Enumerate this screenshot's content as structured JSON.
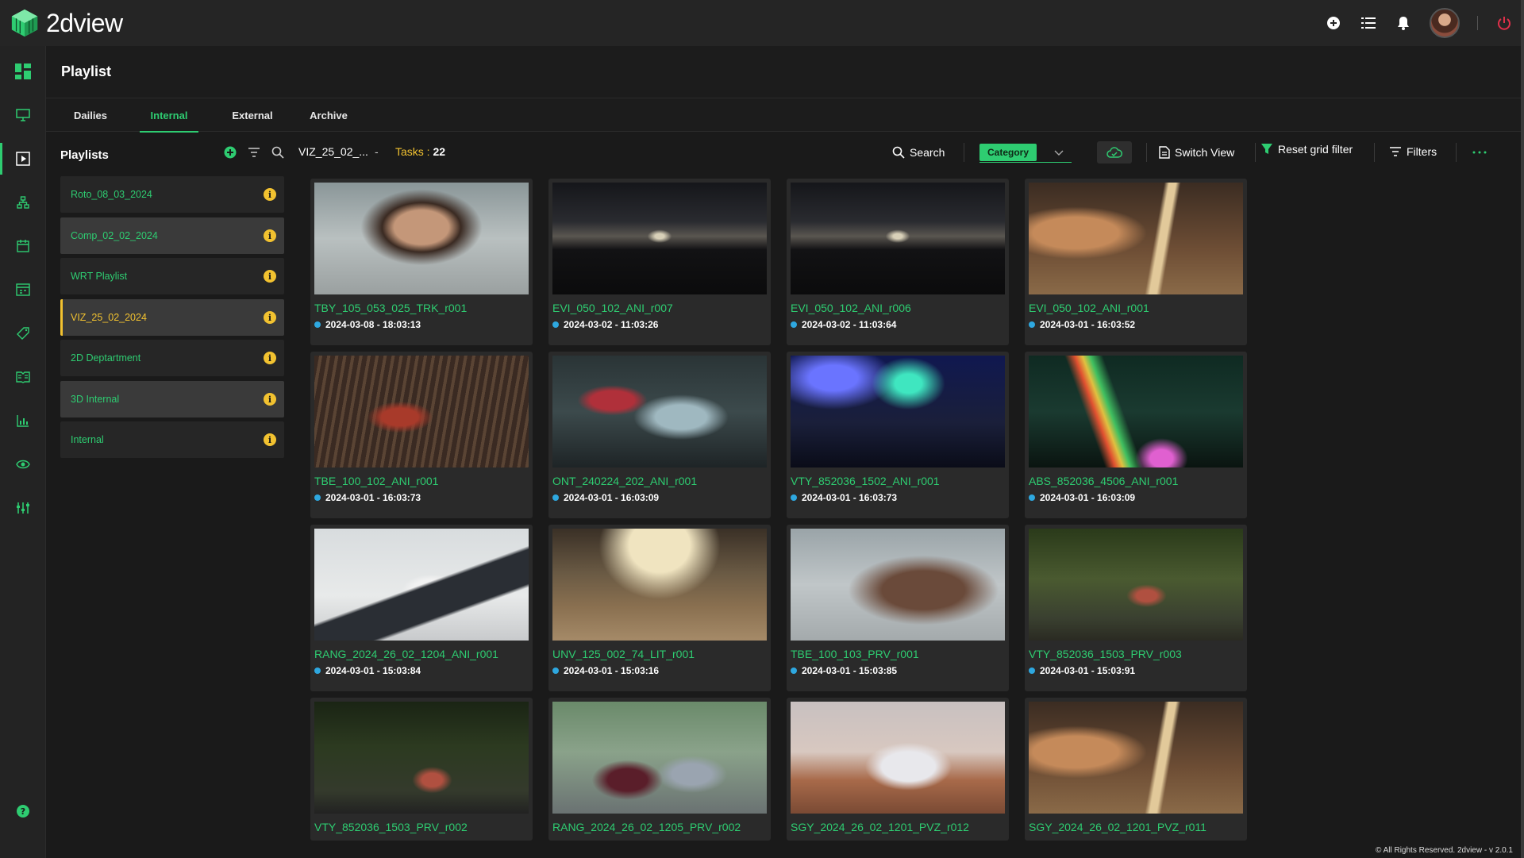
{
  "app": {
    "name": "2dview"
  },
  "colors": {
    "accent": "#2ecc71",
    "warning": "#f2c230",
    "dot": "#2ea8e0",
    "danger": "#e0304a"
  },
  "topbar": {
    "icons": [
      "add-circle-icon",
      "list-icon",
      "bell-icon",
      "avatar",
      "power-icon"
    ]
  },
  "rail": {
    "icons": [
      "dashboard-icon",
      "monitor-icon",
      "play-icon",
      "hierarchy-icon",
      "calendar-icon",
      "schedule-icon",
      "tag-icon",
      "book-icon",
      "bar-chart-icon",
      "eye-icon",
      "equalizer-icon",
      "help-icon"
    ]
  },
  "page": {
    "title": "Playlist"
  },
  "tabs": [
    {
      "label": "Dailies"
    },
    {
      "label": "Internal"
    },
    {
      "label": "External"
    },
    {
      "label": "Archive"
    }
  ],
  "playlists": {
    "title": "Playlists",
    "items": [
      {
        "label": "Roto_08_03_2024"
      },
      {
        "label": "Comp_02_02_2024"
      },
      {
        "label": "WRT Playlist"
      },
      {
        "label": "VIZ_25_02_2024"
      },
      {
        "label": "2D Deptartment"
      },
      {
        "label": "3D Internal"
      },
      {
        "label": "Internal"
      }
    ]
  },
  "toolbar": {
    "crumb": "VIZ_25_02_...",
    "crumb_sep": "-",
    "tasks_label": "Tasks : ",
    "tasks_count": "22",
    "search": "Search",
    "category": "Category",
    "switch_view": "Switch View",
    "reset_filter": "Reset grid filter",
    "filters": "Filters"
  },
  "cards": [
    {
      "title": "TBY_105_053_025_TRK_r001",
      "date": "2024-03-08 - 18:03:13"
    },
    {
      "title": "EVI_050_102_ANI_r007",
      "date": "2024-03-02 - 11:03:26"
    },
    {
      "title": "EVI_050_102_ANI_r006",
      "date": "2024-03-02 - 11:03:64"
    },
    {
      "title": "EVI_050_102_ANI_r001",
      "date": "2024-03-01 - 16:03:52"
    },
    {
      "title": "TBE_100_102_ANI_r001",
      "date": "2024-03-01 - 16:03:73"
    },
    {
      "title": "ONT_240224_202_ANI_r001",
      "date": "2024-03-01 - 16:03:09"
    },
    {
      "title": "VTY_852036_1502_ANI_r001",
      "date": "2024-03-01 - 16:03:73"
    },
    {
      "title": "ABS_852036_4506_ANI_r001",
      "date": "2024-03-01 - 16:03:09"
    },
    {
      "title": "RANG_2024_26_02_1204_ANI_r001",
      "date": "2024-03-01 - 15:03:84"
    },
    {
      "title": "UNV_125_002_74_LIT_r001",
      "date": "2024-03-01 - 15:03:16"
    },
    {
      "title": "TBE_100_103_PRV_r001",
      "date": "2024-03-01 - 15:03:85"
    },
    {
      "title": "VTY_852036_1503_PRV_r003",
      "date": "2024-03-01 - 15:03:91"
    },
    {
      "title": "VTY_852036_1503_PRV_r002",
      "date": ""
    },
    {
      "title": "RANG_2024_26_02_1205_PRV_r002",
      "date": ""
    },
    {
      "title": "SGY_2024_26_02_1201_PVZ_r012",
      "date": ""
    },
    {
      "title": "SGY_2024_26_02_1201_PVZ_r011",
      "date": ""
    }
  ],
  "footer": {
    "text": "© All Rights Reserved. 2dview - v 2.0.1"
  }
}
